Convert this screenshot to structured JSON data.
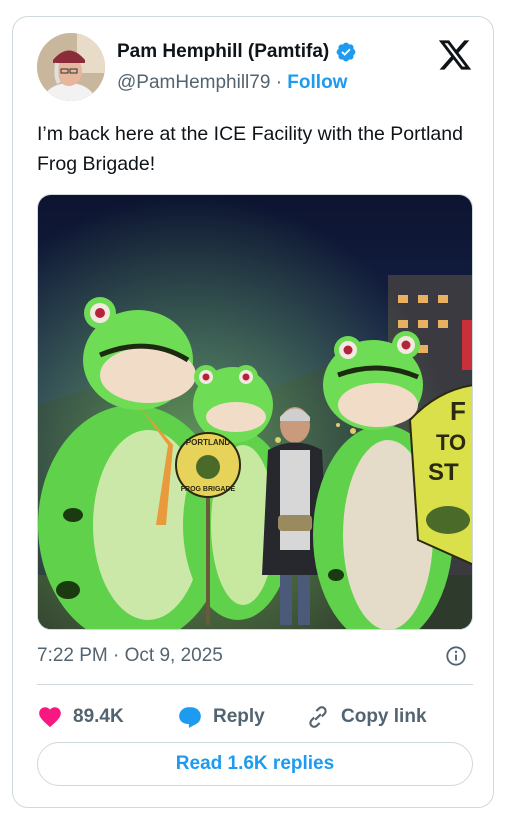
{
  "author": {
    "name": "Pam Hemphill (Pamtifa)",
    "handle": "@PamHemphill79",
    "separator": "·",
    "follow_label": "Follow",
    "verified_icon": "verified-badge-icon"
  },
  "tweet": {
    "text": "I’m back here at the ICE Facility with the Portland Frog Brigade!",
    "sign_text": "PORTLAND FROG BRIGADE",
    "partial_sign_text": "F TO ST",
    "timestamp": "7:22 PM · Oct 9, 2025"
  },
  "actions": {
    "like_count": "89.4K",
    "reply_label": "Reply",
    "copy_link_label": "Copy link"
  },
  "read_replies_label": "Read 1.6K replies",
  "colors": {
    "accent": "#1d9bf0",
    "like": "#f91880",
    "text": "#0f1419",
    "muted": "#536471",
    "border": "#cfd9de",
    "frog_green": "#5fd14a"
  }
}
